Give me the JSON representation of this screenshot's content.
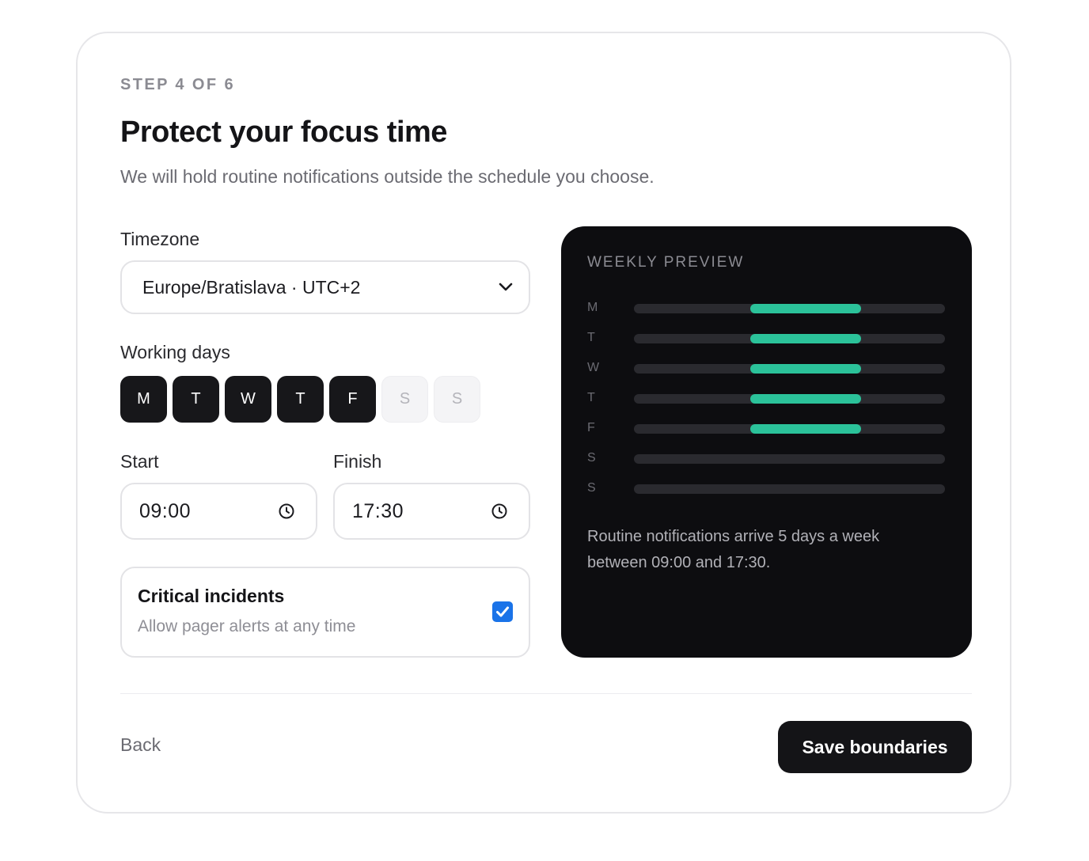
{
  "header": {
    "step": "STEP 4 OF 6",
    "title": "Protect your focus time",
    "subtitle": "We will hold routine notifications outside the schedule you choose."
  },
  "timezone": {
    "label": "Timezone",
    "value": "Europe/Bratislava · UTC+2"
  },
  "working_days": {
    "label": "Working days",
    "days": [
      {
        "label": "M",
        "selected": true
      },
      {
        "label": "T",
        "selected": true
      },
      {
        "label": "W",
        "selected": true
      },
      {
        "label": "T",
        "selected": true
      },
      {
        "label": "F",
        "selected": true
      },
      {
        "label": "S",
        "selected": false
      },
      {
        "label": "S",
        "selected": false
      }
    ]
  },
  "start": {
    "label": "Start",
    "value": "09:00"
  },
  "finish": {
    "label": "Finish",
    "value": "17:30"
  },
  "critical": {
    "title": "Critical incidents",
    "subtitle": "Allow pager alerts at any time",
    "checked": true
  },
  "preview": {
    "title": "WEEKLY PREVIEW",
    "window_start_hour": 9,
    "window_end_hour": 17.5,
    "summary": "Routine notifications arrive 5 days a week between 09:00 and 17:30."
  },
  "footer": {
    "back_label": "Back",
    "save_label": "Save boundaries"
  },
  "colors": {
    "accent": "#2bc29a",
    "checkbox": "#1a73e8",
    "dark": "#141417"
  }
}
